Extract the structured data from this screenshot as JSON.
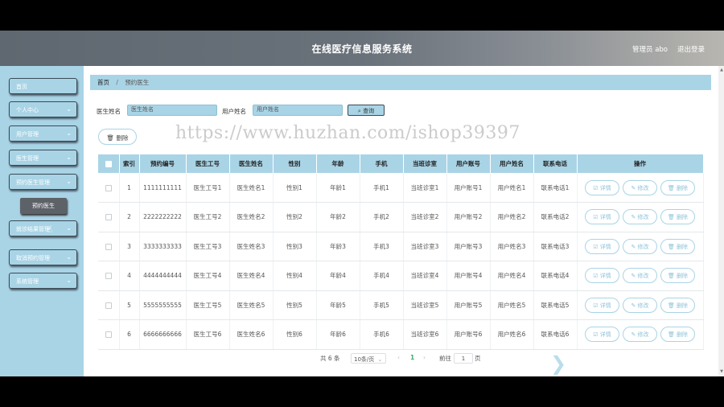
{
  "header": {
    "title": "在线医疗信息服务系统",
    "admin": "管理员 abo",
    "logout": "退出登录"
  },
  "sidebar": {
    "items": [
      {
        "label": "首页",
        "chevron": false
      },
      {
        "label": "个人中心",
        "chevron": true
      },
      {
        "label": "用户管理",
        "chevron": true
      },
      {
        "label": "医生管理",
        "chevron": true
      },
      {
        "label": "预约医生管理",
        "chevron": true
      },
      {
        "label": "就诊结果管理",
        "chevron": true
      },
      {
        "label": "取消预约管理",
        "chevron": true
      },
      {
        "label": "系统管理",
        "chevron": true
      }
    ],
    "submenu": {
      "label": "预约医生"
    }
  },
  "breadcrumb": {
    "home": "首页",
    "separator": "/",
    "current": "预约医生"
  },
  "search": {
    "field1_label": "医生姓名",
    "field1_placeholder": "医生姓名",
    "field2_label": "用户姓名",
    "field2_placeholder": "用户姓名",
    "button_label": "查询"
  },
  "actions": {
    "delete_label": "删除",
    "delete_icon": "trash-icon"
  },
  "table": {
    "headers": [
      "索引",
      "预约编号",
      "医生工号",
      "医生姓名",
      "性别",
      "年龄",
      "手机",
      "当班诊室",
      "用户账号",
      "用户姓名",
      "联系电话",
      "操作"
    ],
    "rows": [
      [
        "1",
        "1111111111",
        "医生工号1",
        "医生姓名1",
        "性别1",
        "年龄1",
        "手机1",
        "当班诊室1",
        "用户账号1",
        "用户姓名1",
        "联系电话1"
      ],
      [
        "2",
        "2222222222",
        "医生工号2",
        "医生姓名2",
        "性别2",
        "年龄2",
        "手机2",
        "当班诊室2",
        "用户账号2",
        "用户姓名2",
        "联系电话2"
      ],
      [
        "3",
        "3333333333",
        "医生工号3",
        "医生姓名3",
        "性别3",
        "年龄3",
        "手机3",
        "当班诊室3",
        "用户账号3",
        "用户姓名3",
        "联系电话3"
      ],
      [
        "4",
        "4444444444",
        "医生工号4",
        "医生姓名4",
        "性别4",
        "年龄4",
        "手机4",
        "当班诊室4",
        "用户账号4",
        "用户姓名4",
        "联系电话4"
      ],
      [
        "5",
        "5555555555",
        "医生工号5",
        "医生姓名5",
        "性别5",
        "年龄5",
        "手机5",
        "当班诊室5",
        "用户账号5",
        "用户姓名5",
        "联系电话5"
      ],
      [
        "6",
        "6666666666",
        "医生工号6",
        "医生姓名6",
        "性别6",
        "年龄6",
        "手机6",
        "当班诊室6",
        "用户账号6",
        "用户姓名6",
        "联系电话6"
      ]
    ],
    "row_actions": {
      "detail": "☑ 详情",
      "edit": "✎ 修改",
      "delete": "🗑 删除"
    }
  },
  "pagination": {
    "total": "共 6 条",
    "page_size": "10条/页",
    "prev": "‹",
    "current_page": "1",
    "next": "›",
    "goto_label": "前往",
    "goto_value": "1",
    "page_suffix": "页"
  },
  "watermark": "https://www.huzhan.com/ishop39397",
  "colors": {
    "accent": "#a9d4e6",
    "header": "#6a7279",
    "pager_active": "#3ea86f"
  }
}
